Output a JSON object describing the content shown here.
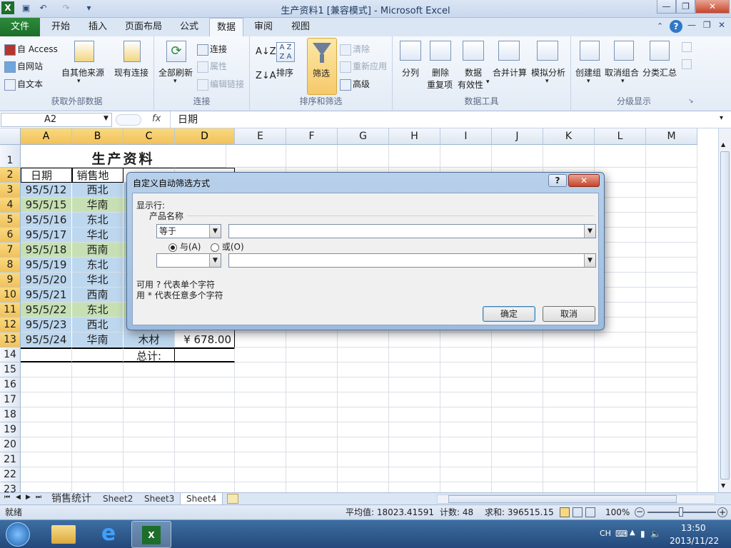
{
  "window": {
    "title": "生产资料1  [兼容模式] - Microsoft Excel"
  },
  "tabs": [
    "文件",
    "开始",
    "插入",
    "页面布局",
    "公式",
    "数据",
    "审阅",
    "视图"
  ],
  "ribbon": {
    "get_external": {
      "label": "获取外部数据",
      "access": "自 Access",
      "web": "自网站",
      "text": "自文本",
      "other": "自其他来源",
      "existing": "现有连接"
    },
    "connections": {
      "label": "连接",
      "refresh": "全部刷新",
      "conn": "连接",
      "props": "属性",
      "edit_links": "编辑链接"
    },
    "sort_filter": {
      "label": "排序和筛选",
      "sort": "排序",
      "filter": "筛选",
      "clear": "清除",
      "reapply": "重新应用",
      "advanced": "高级"
    },
    "data_tools": {
      "label": "数据工具",
      "split": "分列",
      "remove_dup_1": "删除",
      "remove_dup_2": "重复项",
      "validation_1": "数据",
      "validation_2": "有效性",
      "consolidate": "合并计算",
      "whatif": "模拟分析"
    },
    "outline": {
      "label": "分级显示",
      "group": "创建组",
      "ungroup": "取消组合",
      "subtotal": "分类汇总"
    }
  },
  "formula_bar": {
    "name_box": "A2",
    "fx": "fx",
    "value": "日期"
  },
  "columns": [
    "A",
    "B",
    "C",
    "D",
    "E",
    "F",
    "G",
    "H",
    "I",
    "J",
    "K",
    "L",
    "M"
  ],
  "rows": [
    "1",
    "2",
    "3",
    "4",
    "5",
    "6",
    "7",
    "8",
    "9",
    "10",
    "11",
    "12",
    "13",
    "14",
    "15",
    "16",
    "17",
    "18",
    "19",
    "20",
    "21",
    "22",
    "23"
  ],
  "sheet": {
    "title": "生产资料",
    "headers": [
      "日期",
      "销售地"
    ],
    "dates": [
      "95/5/12",
      "95/5/15",
      "95/5/16",
      "95/5/17",
      "95/5/18",
      "95/5/19",
      "95/5/20",
      "95/5/21",
      "95/5/22",
      "95/5/23",
      "95/5/24"
    ],
    "regions": [
      "西北",
      "华南",
      "东北",
      "华北",
      "西南",
      "东北",
      "华北",
      "西南",
      "东北",
      "西北",
      "华南"
    ],
    "row13_product": "木材",
    "row13_amount": "¥   678.00",
    "total_label": "总计:"
  },
  "dialog": {
    "title": "自定义自动筛选方式",
    "show_rows": "显示行:",
    "field": "产品名称",
    "op1": "等于",
    "op2": "",
    "and_label": "与(A)",
    "or_label": "或(O)",
    "hint1": "可用 ? 代表单个字符",
    "hint2": "用 * 代表任意多个字符",
    "ok": "确定",
    "cancel": "取消",
    "help": "?",
    "close": "✕"
  },
  "sheet_tabs": [
    "销售统计",
    "Sheet2",
    "Sheet3",
    "Sheet4"
  ],
  "status": {
    "ready": "就绪",
    "average": "平均值: 18023.41591",
    "count": "计数: 48",
    "sum": "求和: 396515.15",
    "zoom": "100%"
  },
  "taskbar": {
    "lang": "CH",
    "time": "13:50",
    "date": "2013/11/22"
  },
  "colors": {
    "excel_green": "#1d6e2a",
    "select_gold": "#f1c15c",
    "green_row": "#c6e0b4",
    "blue_row": "#bdd7ee"
  }
}
